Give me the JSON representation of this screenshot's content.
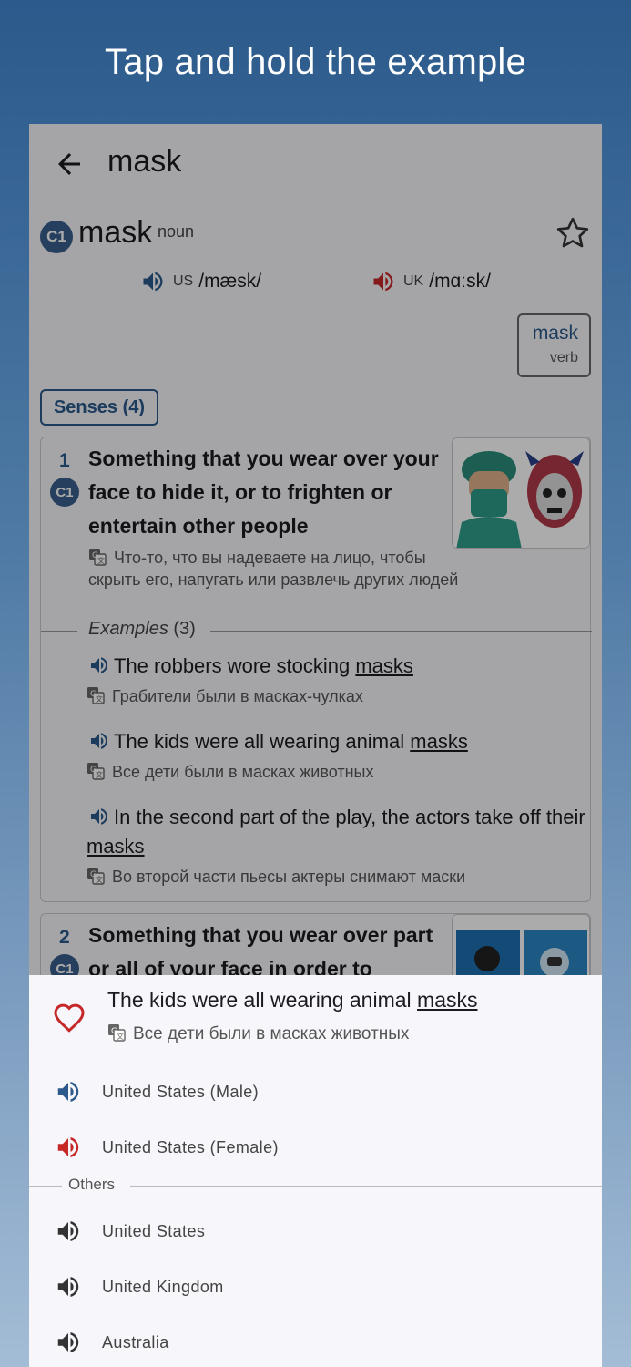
{
  "banner": {
    "text": "Tap and hold the example"
  },
  "appbar": {
    "title": "mask"
  },
  "entry": {
    "level": "C1",
    "headword": "mask",
    "pos": "noun",
    "us_label": "US",
    "us_ipa": "/mæsk/",
    "uk_label": "UK",
    "uk_ipa": "/mɑːsk/"
  },
  "related": {
    "word": "mask",
    "pos": "verb"
  },
  "senses_chip": "Senses (4)",
  "sense1": {
    "number": "1",
    "level": "C1",
    "definition": "Something that you wear over your face to hide it, or to frighten or entertain other people",
    "translation": "Что-то, что вы надеваете на лицо, чтобы скрыть его, напугать или развлечь других людей",
    "examples_label": "Examples",
    "examples_count": "(3)",
    "examples": [
      {
        "pre": "The robbers wore stocking ",
        "word": "masks",
        "ru": "Грабители были в масках-чулках"
      },
      {
        "pre": "The kids were all wearing animal ",
        "word": "masks",
        "ru": "Все дети были в масках животных"
      },
      {
        "pre": "In the second part of the play, the actors take off their ",
        "word": "masks",
        "ru": "Во второй части пьесы актеры снимают маски"
      }
    ]
  },
  "sense2": {
    "number": "2",
    "level": "C1",
    "definition": "Something that you wear over part or all of your face in order to"
  },
  "sheet": {
    "example_pre": "The kids were all wearing animal ",
    "example_word": "masks",
    "example_ru": "Все дети были в масках животных",
    "options": [
      "United States (Male)",
      "United States (Female)"
    ],
    "others_label": "Others",
    "others": [
      "United States",
      "United Kingdom",
      "Australia"
    ]
  },
  "colors": {
    "brand": "#2b5a8b",
    "female": "#c62828",
    "neutral": "#333333",
    "heart": "#c62828"
  }
}
